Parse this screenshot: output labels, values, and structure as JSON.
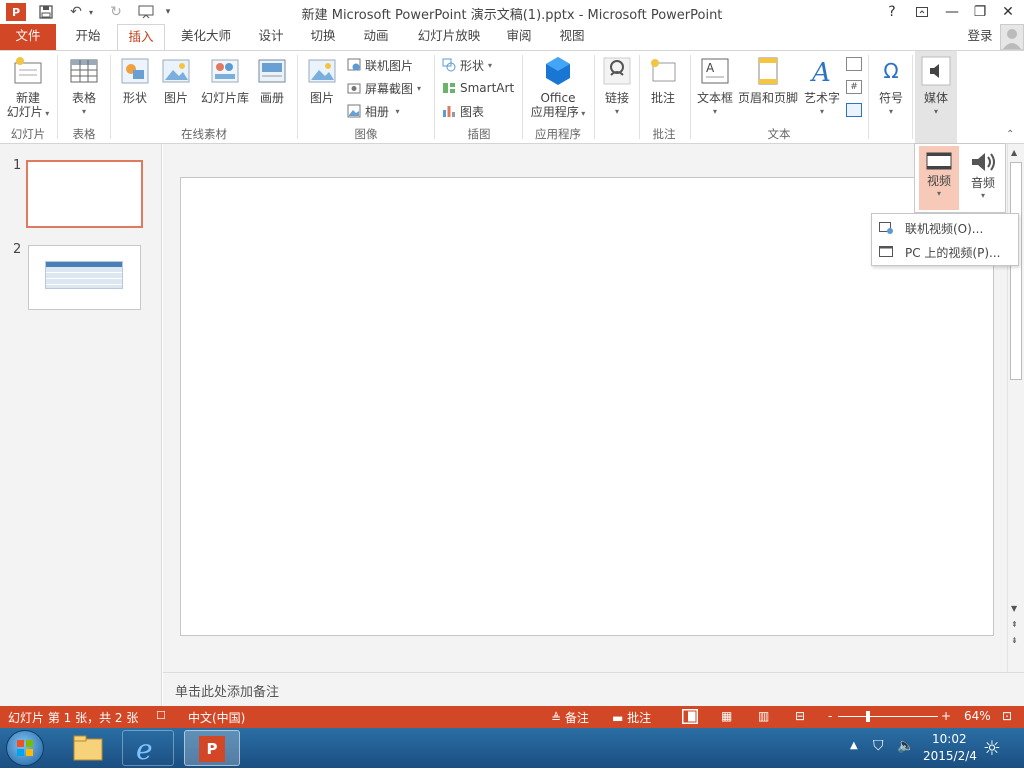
{
  "window": {
    "title": "新建 Microsoft PowerPoint 演示文稿(1).pptx - Microsoft PowerPoint",
    "help": "?",
    "minimize": "—",
    "restore": "❐",
    "close": "✕"
  },
  "tabs": {
    "file": "文件",
    "home": "开始",
    "insert": "插入",
    "design_master": "美化大师",
    "design": "设计",
    "transitions": "切换",
    "animations": "动画",
    "slideshow": "幻灯片放映",
    "review": "审阅",
    "view": "视图",
    "login": "登录"
  },
  "ribbon": {
    "new_slide_1": "新建",
    "new_slide_2": "幻灯片",
    "table": "表格",
    "shapes": "形状",
    "picture": "图片",
    "slide_library": "幻灯片库",
    "album": "画册",
    "images_picture": "图片",
    "online_pictures": "联机图片",
    "screenshot": "屏幕截图",
    "photo_album": "相册",
    "shape_small": "形状",
    "smartart": "SmartArt",
    "chart": "图表",
    "office_apps_1": "Office",
    "office_apps_2": "应用程序",
    "link": "链接",
    "comment": "批注",
    "textbox": "文本框",
    "header_footer": "页眉和页脚",
    "wordart": "艺术字",
    "symbol": "符号",
    "media": "媒体",
    "groups": {
      "slides": "幻灯片",
      "tables": "表格",
      "online_materials": "在线素材",
      "images": "图像",
      "illustrations": "插图",
      "apps": "应用程序",
      "comments": "批注",
      "text": "文本"
    }
  },
  "media_popup": {
    "video": "视频",
    "audio": "音频"
  },
  "video_menu": [
    {
      "label": "联机视频(O)..."
    },
    {
      "label": "PC 上的视频(P)..."
    }
  ],
  "thumbnails": [
    "1",
    "2"
  ],
  "notes_placeholder": "单击此处添加备注",
  "statusbar": {
    "slide_info": "幻灯片 第 1 张，共 2 张",
    "language": "中文(中国)",
    "notes": "备注",
    "comments": "批注",
    "zoom_minus": "-",
    "zoom_plus": "+",
    "zoom": "64%"
  },
  "taskbar": {
    "time": "10:02",
    "date": "2015/2/4"
  },
  "colors": {
    "accent": "#d24726",
    "taskbar": "#1f5a91"
  }
}
